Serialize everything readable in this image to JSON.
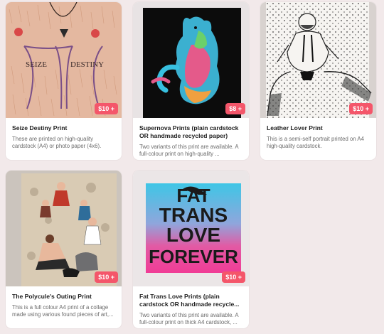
{
  "products": [
    {
      "title": "Seize Destiny Print",
      "description": "These are printed on high-quality cardstock (A4) or photo paper (4x6).",
      "price": "$10 +",
      "image_text": [
        "SEIZE",
        "DESTINY"
      ]
    },
    {
      "title": "Supernova Prints (plain cardstock OR handmade recycled paper)",
      "description": "Two variants of this print are available. A full-colour print on high-quality ...",
      "price": "$8 +"
    },
    {
      "title": "Leather Lover Print",
      "description": "This is a semi-self portrait printed on A4 high-quality cardstock.",
      "price": "$10 +"
    },
    {
      "title": "The Polycule's Outing Print",
      "description": "This is a full colour A4 print of a collage made using various found pieces of art,...",
      "price": "$10 +"
    },
    {
      "title": "Fat Trans Love Prints (plain cardstock OR handmade recycle...",
      "description": "Two variants of this print are available. A full-colour print on thick A4 cardstock, ...",
      "price": "$10 +",
      "image_text": [
        "FAT",
        "TRANS",
        "LOVE",
        "FOREVER"
      ]
    }
  ]
}
